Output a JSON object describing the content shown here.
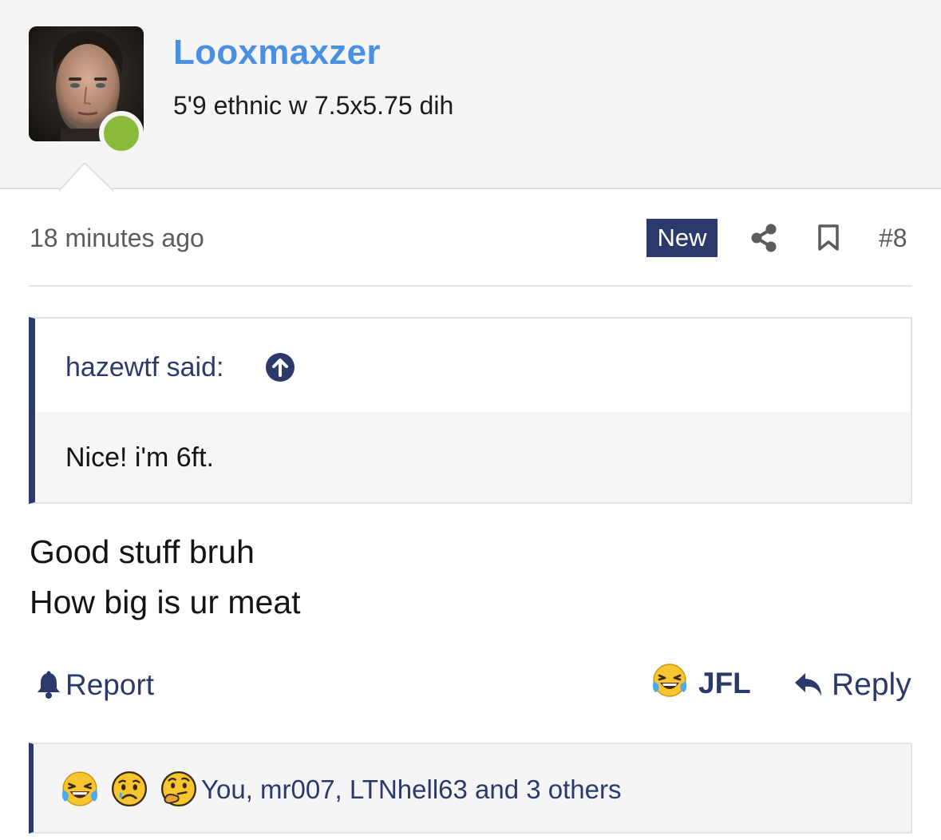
{
  "user": {
    "name": "Looxmaxzer",
    "title": "5'9 ethnic w 7.5x5.75 dih",
    "status": "online",
    "status_color": "#8cba3a",
    "name_color": "#4a90e2",
    "avatar_icon": "user-photo"
  },
  "post": {
    "time": "18 minutes ago",
    "badge": "New",
    "number": "#8",
    "share_icon": "share-icon",
    "bookmark_icon": "bookmark-icon"
  },
  "quote": {
    "author": "hazewtf said:",
    "jump_icon": "arrow-up-circle-icon",
    "text": "Nice! i'm 6ft."
  },
  "message": {
    "lines": [
      "Good stuff bruh",
      "How big is ur meat"
    ]
  },
  "actions": {
    "report_label": "Report",
    "report_icon": "bell-icon",
    "reaction_label": "JFL",
    "reaction_icon": "laughing-crying-emoji",
    "reply_label": "Reply",
    "reply_icon": "reply-arrow-icon"
  },
  "reactions": {
    "emojis": [
      "laughing-crying-emoji",
      "sad-emoji",
      "thinking-emoji"
    ],
    "summary": "You, mr007, LTNhell63 and 3 others"
  },
  "colors": {
    "accent": "#2b3a6b",
    "header_bg": "#f5f5f5"
  }
}
